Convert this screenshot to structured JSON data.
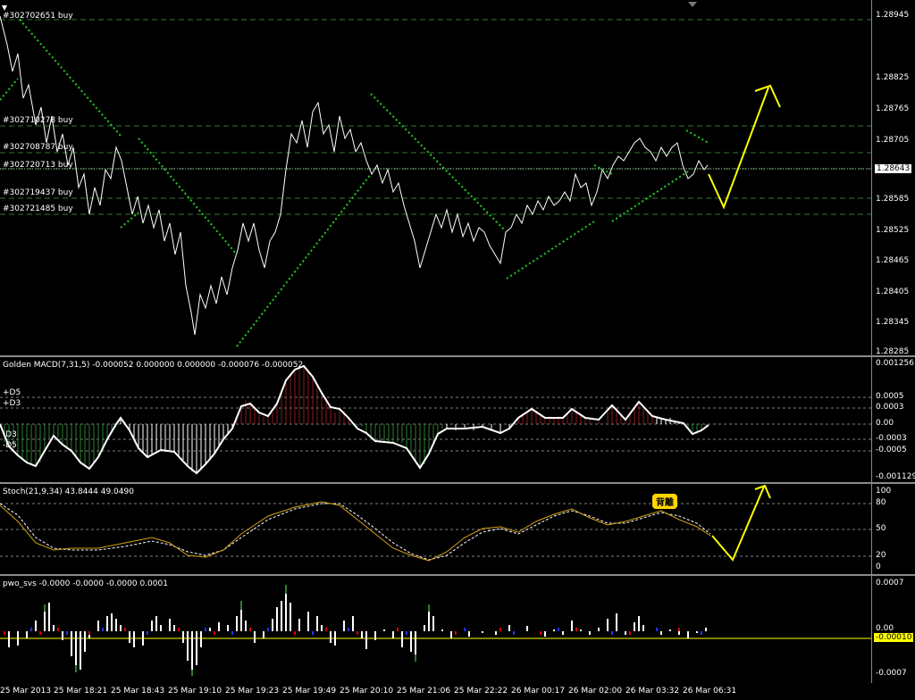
{
  "main_pane": {
    "price_scale": [
      "1.28945",
      "1.28825",
      "1.28765",
      "1.28705",
      "1.28643",
      "1.28585",
      "1.28525",
      "1.28465",
      "1.28405",
      "1.28345",
      "1.28285"
    ],
    "current_price": "1.28643",
    "order_labels": [
      "#302702651 buy",
      "#302710278 buy",
      "#302708787 buy",
      "#302720713 buy",
      "#302719437 buy",
      "#302721485 buy"
    ]
  },
  "macd_pane": {
    "title": "Golden MACD(7,31,5) -0.000052 0.000000 0.000000 -0.000076 -0.000052",
    "levels": [
      "+D5",
      "+D3",
      "-D3",
      "-D5"
    ],
    "scale": [
      "0.001256",
      "0.0005",
      "0.0003",
      "0.00",
      "-0.0003",
      "-0.0005",
      "-0.001129"
    ]
  },
  "stoch_pane": {
    "title": "Stoch(21,9,34) 43.8444 49.0490",
    "scale": [
      "100",
      "80",
      "50",
      "20",
      "0"
    ],
    "annotation": "背離"
  },
  "pwo_pane": {
    "title": "pwo_svs -0.0000 -0.0000 -0.0000 0.0001",
    "scale": [
      "0.0007",
      "0.00",
      "-0.00010",
      "-0.0007"
    ],
    "current": "-0.00010"
  },
  "time_axis": [
    "25 Mar 2013",
    "25 Mar 18:21",
    "25 Mar 18:43",
    "25 Mar 19:10",
    "25 Mar 19:23",
    "25 Mar 19:49",
    "25 Mar 20:10",
    "25 Mar 21:06",
    "25 Mar 22:22",
    "26 Mar 00:17",
    "26 Mar 02:00",
    "26 Mar 03:32",
    "26 Mar 06:31"
  ],
  "colors": {
    "price_line": "#ffffff",
    "trend_dots": "#22cc22",
    "order_line": "#2e7d32",
    "arrow": "#ffff00",
    "macd_up": "#8b1a1a",
    "macd_down": "#2e7d32",
    "stoch_main": "#d4a017",
    "stoch_signal": "#ffffff"
  }
}
